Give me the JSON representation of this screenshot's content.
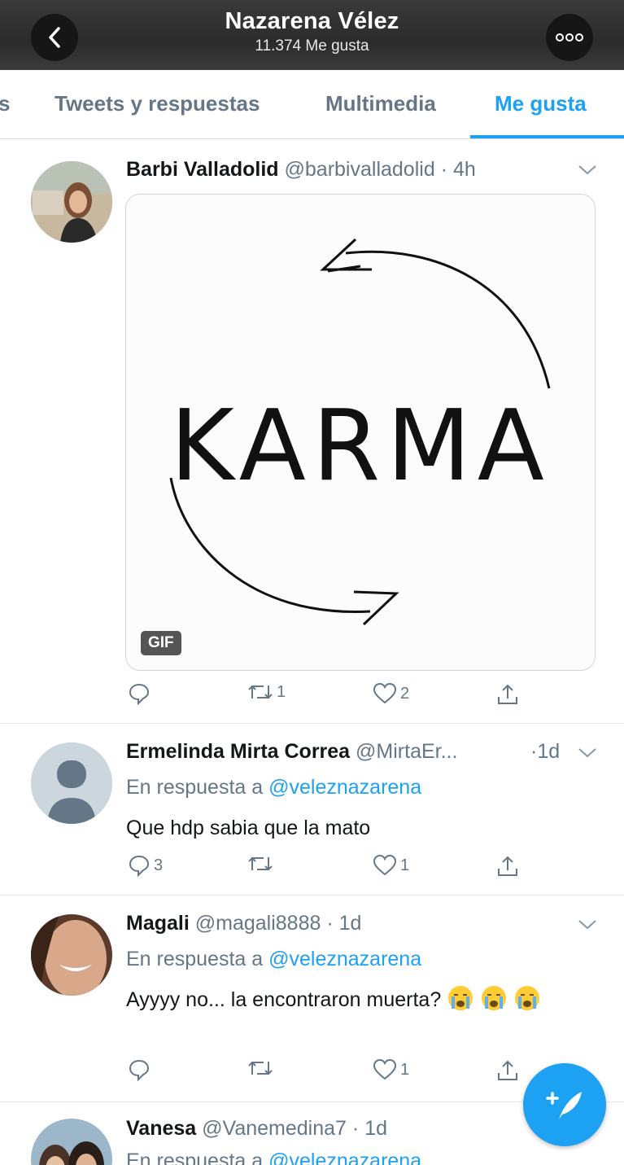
{
  "header": {
    "title": "Nazarena Vélez",
    "subtitle": "11.374 Me gusta"
  },
  "tabs": [
    {
      "label": "s"
    },
    {
      "label": "Tweets y respuestas"
    },
    {
      "label": "Multimedia"
    },
    {
      "label": "Me gusta",
      "active": true
    }
  ],
  "tweets": [
    {
      "name": "Barbi Valladolid",
      "handle": "@barbivalladolid",
      "time": "· 4h",
      "media": {
        "text": "KARMA",
        "badge": "GIF"
      },
      "replies": "",
      "retweets": "1",
      "likes": "2"
    },
    {
      "name": "Ermelinda Mirta Correa",
      "handle": "@MirtaEr...",
      "time": "·1d",
      "reply_prefix": "En respuesta a",
      "reply_mention": "@veleznazarena",
      "text": "Que hdp sabia que la mato",
      "replies": "3",
      "retweets": "",
      "likes": "1"
    },
    {
      "name": "Magali",
      "handle": "@magali8888",
      "time": "· 1d",
      "reply_prefix": "En respuesta a",
      "reply_mention": "@veleznazarena",
      "text": "Ayyyy no... la encontraron muerta?",
      "replies": "",
      "retweets": "",
      "likes": "1"
    },
    {
      "name": "Vanesa",
      "handle": "@Vanemedina7",
      "time": "· 1d",
      "reply_prefix": "En respuesta a",
      "reply_mention": "@veleznazarena"
    }
  ],
  "colors": {
    "accent": "#1da1f2",
    "text_secondary": "#657786"
  }
}
